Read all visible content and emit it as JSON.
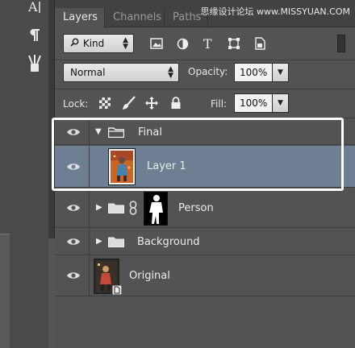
{
  "watermark": "思缘设计论坛 www.MISSYUAN.COM",
  "tools": {
    "char_icon": "character-text-icon",
    "para_icon": "paragraph-icon",
    "brush_icon": "brush-presets-icon"
  },
  "tabs": [
    {
      "label": "Layers",
      "active": true
    },
    {
      "label": "Channels",
      "active": false
    },
    {
      "label": "Paths",
      "active": false
    }
  ],
  "filter": {
    "kind_label": "Kind",
    "icons": [
      "image-filter-icon",
      "adjustment-filter-icon",
      "type-filter-icon",
      "shape-filter-icon",
      "smart-object-filter-icon"
    ]
  },
  "blend": {
    "mode": "Normal",
    "opacity_label": "Opacity:",
    "opacity_value": "100%"
  },
  "lock": {
    "label": "Lock:",
    "icons": [
      "lock-transparent-icon",
      "lock-image-icon",
      "lock-position-icon",
      "lock-all-icon"
    ],
    "fill_label": "Fill:",
    "fill_value": "100%"
  },
  "layers": [
    {
      "name": "Final",
      "type": "group",
      "expanded": true,
      "selected": false
    },
    {
      "name": "Layer 1",
      "type": "pixel",
      "selected": true
    },
    {
      "name": "Person",
      "type": "group",
      "expanded": false,
      "has_mask": true,
      "selected": false
    },
    {
      "name": "Background",
      "type": "group",
      "expanded": false,
      "selected": false
    },
    {
      "name": "Original",
      "type": "smart-object",
      "selected": false
    }
  ],
  "colors": {
    "selected_row": "#6e7f94",
    "panel_bg": "#535353",
    "highlight_border": "#ffffff"
  }
}
